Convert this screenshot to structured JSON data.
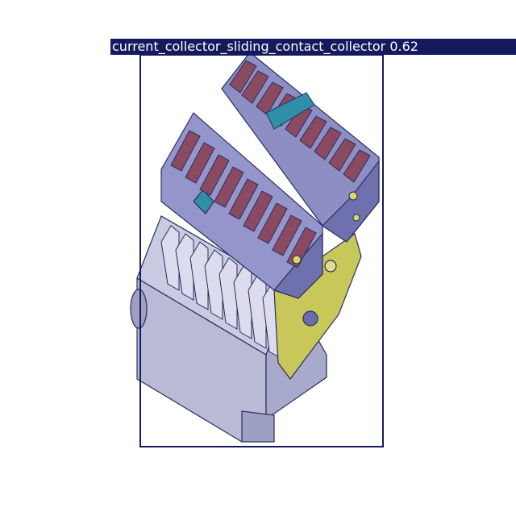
{
  "detection": {
    "class_name": "current_collector_sliding_contact_collector",
    "confidence": "0.62",
    "box_color": "#15195e",
    "label_text_color": "#ffffff"
  },
  "object_colors": {
    "housing": "#8d8fc4",
    "housing_dark": "#5f61a0",
    "contact_caps": "#8a4b62",
    "bracket": "#c8c85a",
    "accent_teal": "#2f8fa8",
    "outline": "#2a2d5a"
  }
}
